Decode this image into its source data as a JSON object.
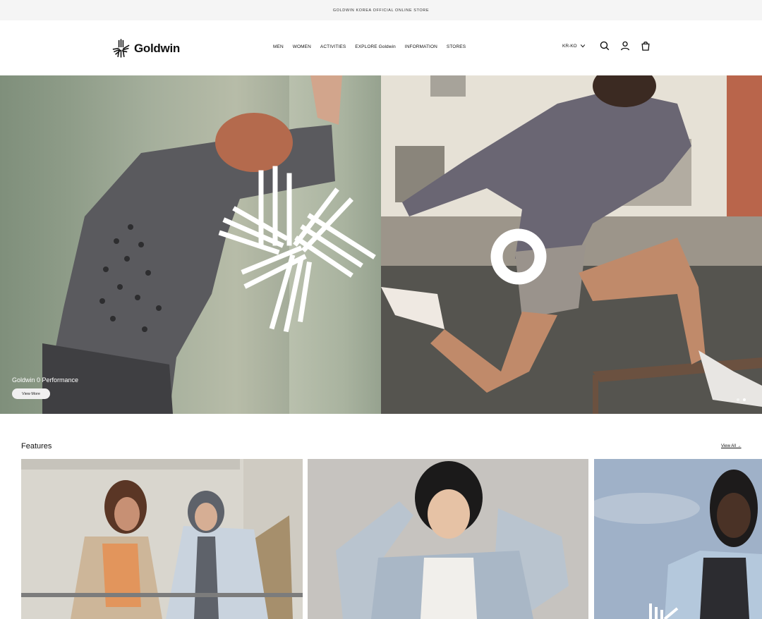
{
  "announcement": {
    "text": "GOLDWIN KOREA OFFICIAL ONLINE STORE"
  },
  "header": {
    "logo_text": "Goldwin",
    "nav": [
      {
        "label": "MEN"
      },
      {
        "label": "WOMEN"
      },
      {
        "label": "ACTIVITIES"
      },
      {
        "label": "EXPLORE Goldwin"
      },
      {
        "label": "INFORMATION"
      },
      {
        "label": "STORES"
      }
    ],
    "lang_label": "KR-KO",
    "icons": [
      "search-icon",
      "account-icon",
      "cart-icon",
      "chevron-down-icon"
    ]
  },
  "hero": {
    "title": "Goldwin 0 Performance",
    "button_label": "View More",
    "slide_count": 2,
    "active_slide": 2,
    "colors": {
      "button_bg": "#f0f0f0",
      "text": "#ffffff"
    }
  },
  "features": {
    "title": "Features",
    "view_all_label": "View All →"
  }
}
